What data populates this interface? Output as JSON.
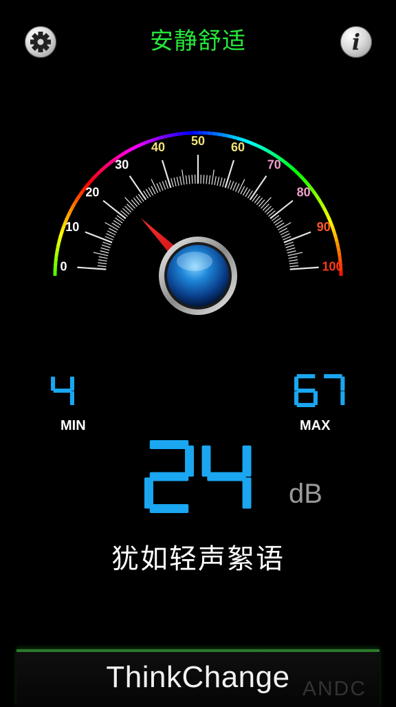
{
  "header": {
    "title": "安静舒适",
    "settings_icon": "gear-icon",
    "info_icon": "info-icon",
    "info_glyph": "i"
  },
  "gauge": {
    "min": 0,
    "max": 100,
    "value": 24,
    "tick_labels": [
      "0",
      "10",
      "20",
      "30",
      "40",
      "50",
      "60",
      "70",
      "80",
      "90",
      "100"
    ],
    "label_colors": [
      "#ffffff",
      "#ffffff",
      "#ffffff",
      "#ffffff",
      "#f3e27a",
      "#f3e27a",
      "#f3e27a",
      "#f0a0c8",
      "#f0a0c8",
      "#ff5a2a",
      "#ff3a1a"
    ]
  },
  "readings": {
    "min_value": "4",
    "min_label": "MIN",
    "max_value": "67",
    "max_label": "MAX",
    "current_value": "24",
    "unit": "dB"
  },
  "description": "犹如轻声絮语",
  "footer": {
    "brand": "ThinkChange",
    "watermark": "ANDC"
  }
}
